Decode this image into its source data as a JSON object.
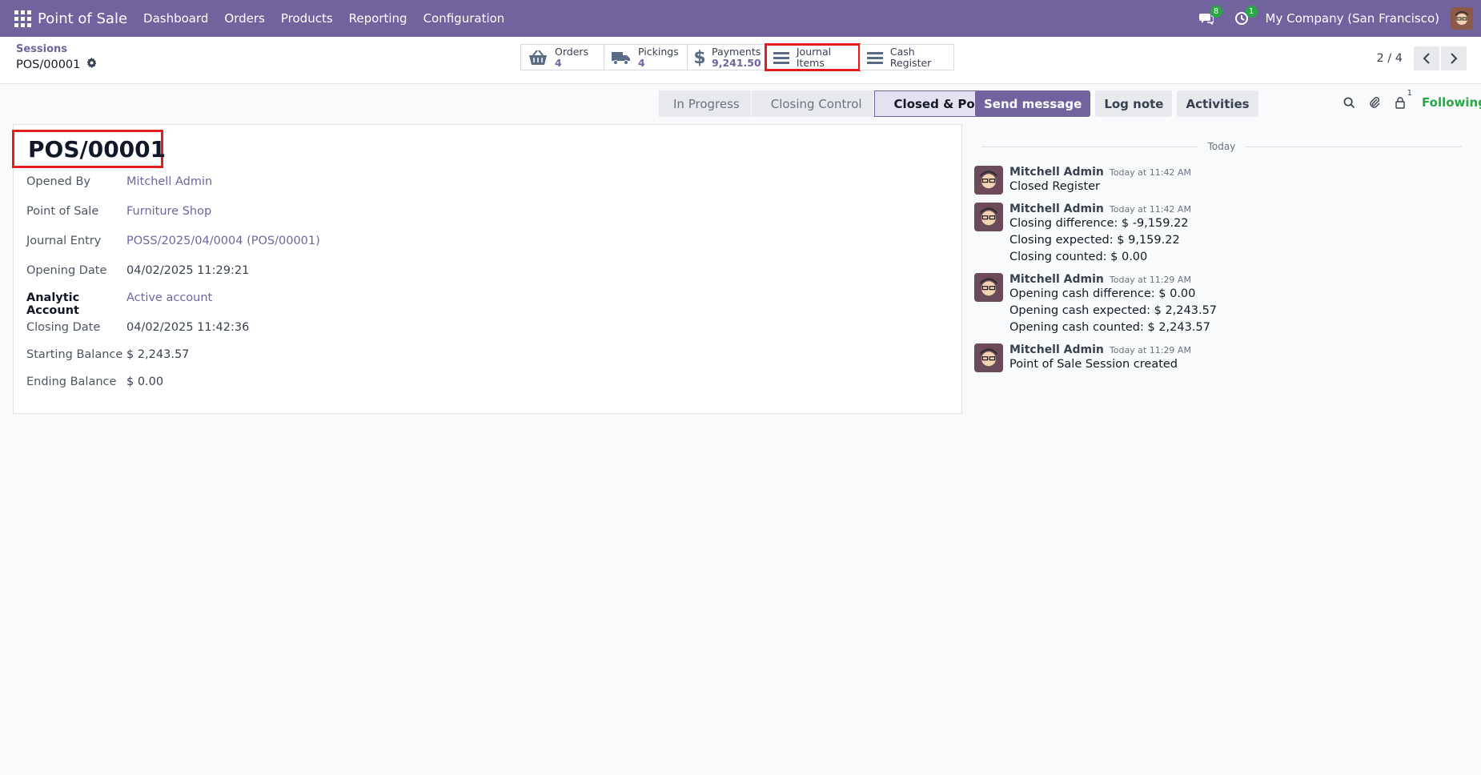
{
  "navbar": {
    "brand": "Point of Sale",
    "menu": [
      "Dashboard",
      "Orders",
      "Products",
      "Reporting",
      "Configuration"
    ],
    "messages_badge": "8",
    "activities_badge": "1",
    "company": "My Company (San Francisco)"
  },
  "breadcrumb": {
    "parent": "Sessions",
    "current": "POS/00001"
  },
  "smart_buttons": [
    {
      "label": "Orders",
      "value": "4",
      "icon": "basket-icon"
    },
    {
      "label": "Pickings",
      "value": "4",
      "icon": "truck-icon"
    },
    {
      "label": "Payments",
      "value": "9,241.50",
      "icon": "dollar-icon"
    },
    {
      "label": "Journal Items",
      "value": "",
      "icon": "list-icon"
    },
    {
      "label": "Cash Register",
      "value": "",
      "icon": "list-icon"
    }
  ],
  "pager": {
    "value": "2 / 4"
  },
  "statusbar": {
    "stages": [
      "In Progress",
      "Closing Control",
      "Closed & Posted"
    ],
    "active": "Closed & Posted"
  },
  "form": {
    "title": "POS/00001",
    "fields": [
      {
        "label": "Opened By",
        "value": "Mitchell Admin"
      },
      {
        "label": "Point of Sale",
        "value": "Furniture Shop"
      },
      {
        "label": "Journal Entry",
        "value": "POSS/2025/04/0004 (POS/00001)"
      },
      {
        "label": "Opening Date",
        "value": "04/02/2025 11:29:21"
      },
      {
        "label": "Analytic Account",
        "value": "Active account"
      },
      {
        "label": "Closing Date",
        "value": "04/02/2025 11:42:36"
      },
      {
        "label": "Starting Balance",
        "value": "$ 2,243.57"
      },
      {
        "label": "Ending Balance",
        "value": "$ 0.00"
      }
    ]
  },
  "chatter": {
    "send_message": "Send message",
    "log_note": "Log note",
    "activities": "Activities",
    "followers_count": "1",
    "following": "Following",
    "separator": "Today",
    "messages": [
      {
        "author": "Mitchell Admin",
        "date": "Today at 11:42 AM",
        "lines": [
          "Closed Register"
        ]
      },
      {
        "author": "Mitchell Admin",
        "date": "Today at 11:42 AM",
        "lines": [
          "Closing difference: $ -9,159.22",
          "Closing expected: $ 9,159.22",
          "Closing counted: $ 0.00"
        ]
      },
      {
        "author": "Mitchell Admin",
        "date": "Today at 11:29 AM",
        "lines": [
          "Opening cash difference: $ 0.00",
          "Opening cash expected: $ 2,243.57",
          "Opening cash counted: $ 2,243.57"
        ]
      },
      {
        "author": "Mitchell Admin",
        "date": "Today at 11:29 AM",
        "lines": [
          "Point of Sale Session created"
        ]
      }
    ]
  },
  "colors": {
    "brand": "#71639e",
    "highlight": "#e11d20",
    "following": "#28a745"
  }
}
